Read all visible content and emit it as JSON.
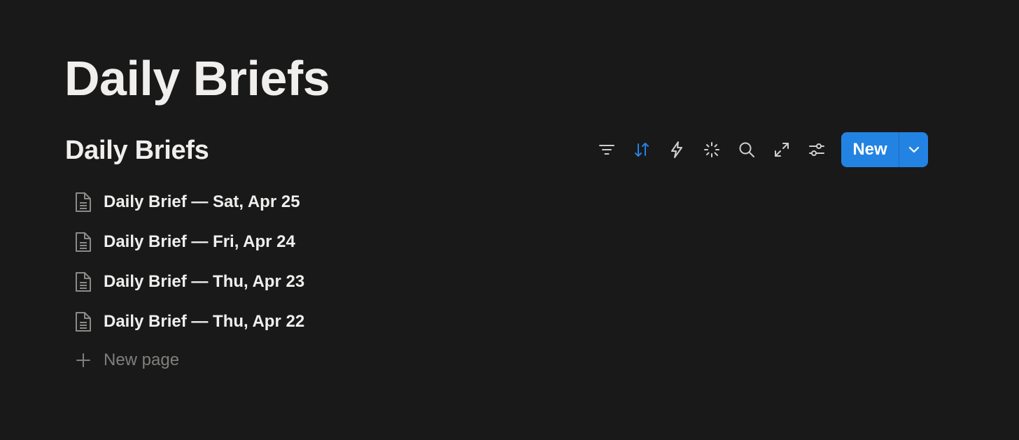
{
  "page": {
    "title": "Daily Briefs"
  },
  "database": {
    "title": "Daily Briefs",
    "toolbar": {
      "icons": [
        "filter-icon",
        "sort-icon",
        "lightning-icon",
        "sparkle-icon",
        "search-icon",
        "expand-icon",
        "settings-sliders-icon"
      ],
      "new_label": "New",
      "accent_color": "#2383e2",
      "sort_active_color": "#2383e2"
    },
    "rows": [
      {
        "title": "Daily Brief — Sat, Apr 25",
        "icon": "page-icon"
      },
      {
        "title": "Daily Brief — Fri, Apr 24",
        "icon": "page-icon"
      },
      {
        "title": "Daily Brief — Thu, Apr 23",
        "icon": "page-icon"
      },
      {
        "title": "Daily Brief — Thu, Apr 22",
        "icon": "page-icon"
      }
    ],
    "new_page_label": "New page"
  }
}
